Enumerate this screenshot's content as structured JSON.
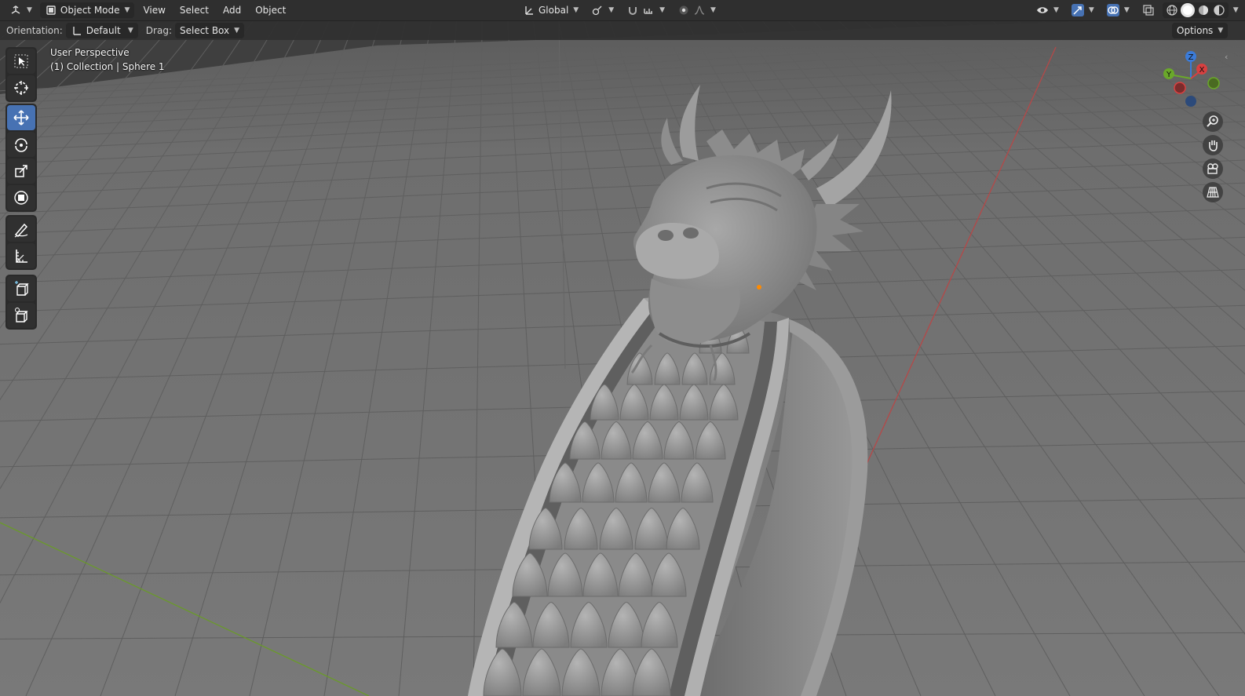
{
  "header": {
    "editor_type_icon": "3d-viewport-icon",
    "mode": "Object Mode",
    "menus": [
      "View",
      "Select",
      "Add",
      "Object"
    ],
    "transform_orientation": "Global"
  },
  "tool_settings": {
    "orientation_label": "Orientation:",
    "orientation_value": "Default",
    "drag_label": "Drag:",
    "drag_value": "Select Box",
    "options_label": "Options"
  },
  "viewport": {
    "view_name": "User Perspective",
    "collection_info": "(1) Collection | Sphere 1",
    "background_color": "#3d3d3d",
    "grid_color": "#4a4a4a",
    "x_axis_color": "#b54848",
    "y_axis_color": "#6a9a2a",
    "model_color": "#8f8f8f"
  },
  "gizmo": {
    "x": "X",
    "y": "Y",
    "z": "Z"
  },
  "tools": [
    {
      "name": "select-box-tool",
      "active": false
    },
    {
      "name": "cursor-tool",
      "active": false
    },
    {
      "name": "move-tool",
      "active": true
    },
    {
      "name": "rotate-tool",
      "active": false
    },
    {
      "name": "scale-tool",
      "active": false
    },
    {
      "name": "transform-tool",
      "active": false
    },
    {
      "name": "annotate-tool",
      "active": false
    },
    {
      "name": "measure-tool",
      "active": false
    },
    {
      "name": "add-cube-tool",
      "active": false
    },
    {
      "name": "extrude-tool",
      "active": false
    }
  ],
  "colors": {
    "accent": "#4772b3",
    "header_bg": "#2f2f2f"
  }
}
